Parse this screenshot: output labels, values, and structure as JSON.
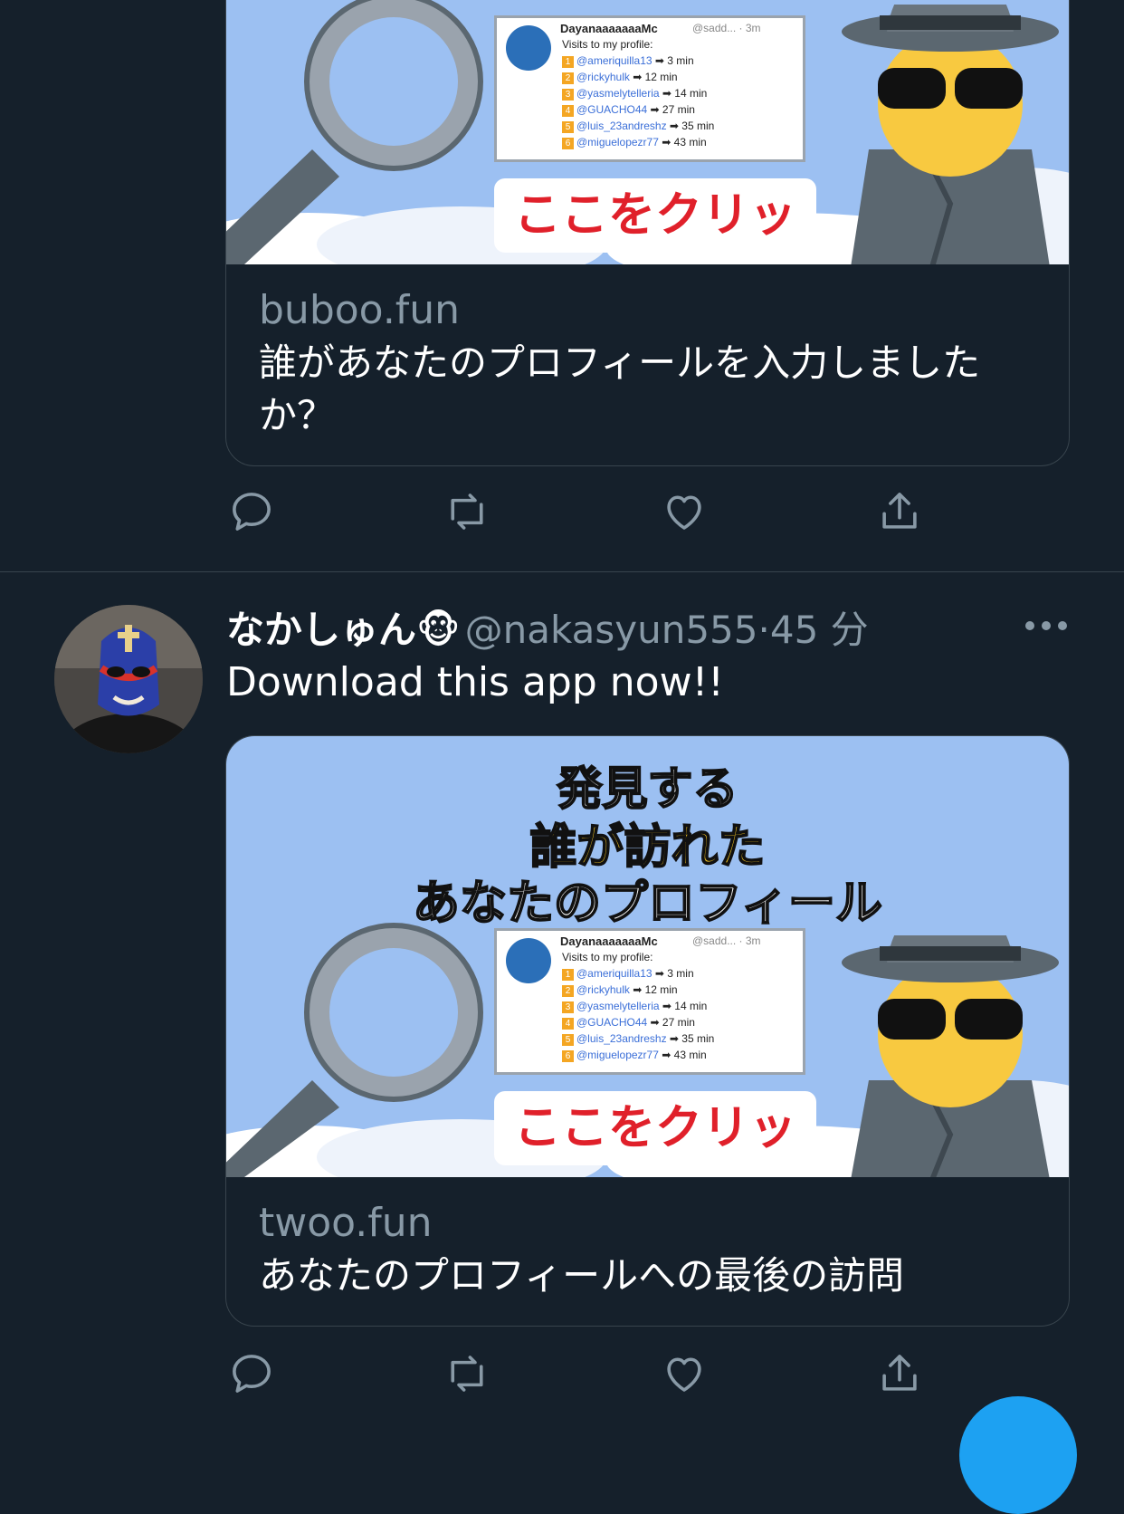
{
  "tweets": [
    {
      "card": {
        "domain": "buboo.fun",
        "title": "誰があなたのプロフィールを入力しましたか？",
        "image": {
          "panel": {
            "name": "DayanaaaaaaaMc",
            "meta": "@sadd... · 3m",
            "intro": "Visits to my profile:",
            "rows": [
              {
                "n": "1",
                "who": "@ameriquilla13",
                "t": "➡ 3 min"
              },
              {
                "n": "2",
                "who": "@rickyhulk",
                "t": "➡ 12 min"
              },
              {
                "n": "3",
                "who": "@yasmelytelleria",
                "t": "➡ 14 min"
              },
              {
                "n": "4",
                "who": "@GUACHO44",
                "t": "➡ 27 min"
              },
              {
                "n": "5",
                "who": "@luis_23andreshz",
                "t": "➡ 35 min"
              },
              {
                "n": "6",
                "who": "@miguelopezr77",
                "t": "➡ 43 min"
              }
            ]
          },
          "button": "ここをクリック"
        }
      }
    },
    {
      "name": "なかしゅん🐵",
      "handle": "@nakasyun555",
      "separator": "·",
      "time": "45 分",
      "text": "Download this app now!!",
      "card": {
        "domain": "twoo.fun",
        "title": "あなたのプロフィールへの最後の訪問",
        "image": {
          "heading": [
            "発見する",
            "誰が訪れた",
            "あなたのプロフィール"
          ],
          "panel": {
            "name": "DayanaaaaaaaMc",
            "meta": "@sadd... · 3m",
            "intro": "Visits to my profile:",
            "rows": [
              {
                "n": "1",
                "who": "@ameriquilla13",
                "t": "➡ 3 min"
              },
              {
                "n": "2",
                "who": "@rickyhulk",
                "t": "➡ 12 min"
              },
              {
                "n": "3",
                "who": "@yasmelytelleria",
                "t": "➡ 14 min"
              },
              {
                "n": "4",
                "who": "@GUACHO44",
                "t": "➡ 27 min"
              },
              {
                "n": "5",
                "who": "@luis_23andreshz",
                "t": "➡ 35 min"
              },
              {
                "n": "6",
                "who": "@miguelopezr77",
                "t": "➡ 43 min"
              }
            ]
          },
          "button": "ここをクリック"
        }
      }
    }
  ],
  "icons": {
    "reply": "reply-icon",
    "retweet": "retweet-icon",
    "like": "heart-icon",
    "share": "share-icon",
    "more": "more-icon"
  },
  "colors": {
    "background": "#15202b",
    "border": "#38444d",
    "secondary_text": "#8899a6",
    "accent": "#1da1f2",
    "ad_sky": "#9cc0f2",
    "ad_button_text": "#e0202a",
    "ad_heading_yellow": "#f7c823"
  }
}
